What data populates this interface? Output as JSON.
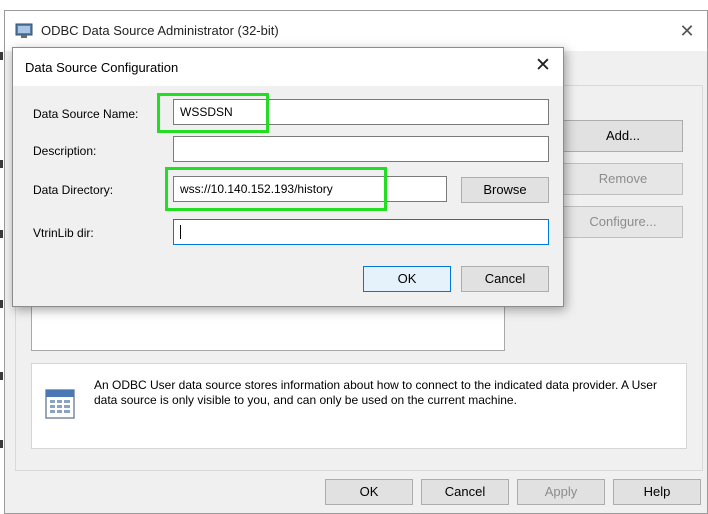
{
  "window": {
    "title": "ODBC Data Source Administrator (32-bit)",
    "close_icon": "close-icon"
  },
  "side_buttons": {
    "add": "Add...",
    "remove": "Remove",
    "configure": "Configure..."
  },
  "info": {
    "text": "An ODBC User data source stores information about how to connect to the indicated data provider.   A User data source is only visible to you, and can only be used on the current machine."
  },
  "footer": {
    "ok": "OK",
    "cancel": "Cancel",
    "apply": "Apply",
    "help": "Help"
  },
  "dialog": {
    "title": "Data Source Configuration",
    "fields": {
      "dsn_label": "Data Source Name:",
      "dsn_value": "WSSDSN",
      "description_label": "Description:",
      "description_value": "",
      "directory_label": "Data Directory:",
      "directory_value": "wss://10.140.152.193/history",
      "vtrinlib_label": "VtrinLib dir:",
      "vtrinlib_value": ""
    },
    "browse": "Browse",
    "ok": "OK",
    "cancel": "Cancel"
  },
  "colors": {
    "highlight": "#22dd22",
    "focus": "#0078d7"
  }
}
